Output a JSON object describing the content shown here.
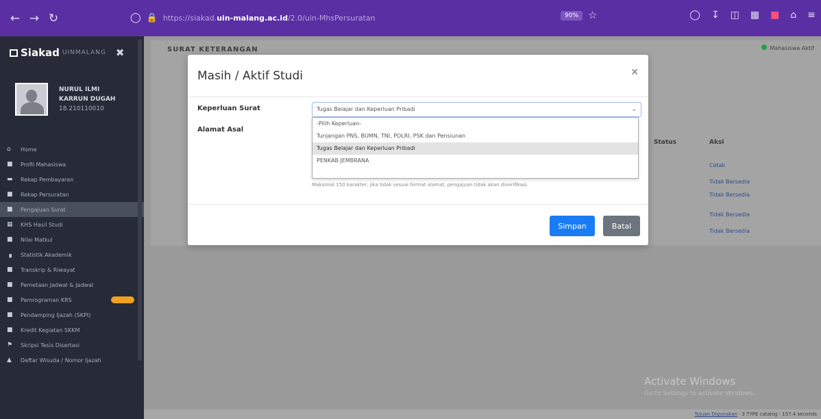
{
  "browser": {
    "url_prefix": "https://siakad.",
    "url_host": "uin-malang.ac.id",
    "url_path": "/2.0/uin-MhsPersuratan",
    "zoom": "90%"
  },
  "sidebar": {
    "brand": "Siakad",
    "brand_sub": "UINMALANG",
    "profile_name_1": "NURUL ILMI",
    "profile_name_2": "KARRUN DUGAH",
    "profile_nim": "18.210110010",
    "items": [
      {
        "label": "Home",
        "icon": "home-icon"
      },
      {
        "label": "Profil Mahasiswa",
        "icon": "user-icon"
      },
      {
        "label": "Rekap Pembayaran",
        "icon": "card-icon"
      },
      {
        "label": "Rekap Persuratan",
        "icon": "doc-icon"
      },
      {
        "label": "Pengajuan Surat",
        "icon": "doc-icon"
      },
      {
        "label": "KHS Hasil Studi",
        "icon": "grid-icon"
      },
      {
        "label": "Nilai Matkul",
        "icon": "doc-icon"
      },
      {
        "label": "Statistik Akademik",
        "icon": "chart-icon"
      },
      {
        "label": "Transkrip & Riwayat",
        "icon": "doc-icon"
      },
      {
        "label": "Pemetaan Jadwal & Jadwal",
        "icon": "doc-icon"
      },
      {
        "label": "Pemrograman KRS",
        "icon": "doc-icon"
      },
      {
        "label": "Pendamping Ijazah (SKPI)",
        "icon": "doc-icon"
      },
      {
        "label": "Kredit Kegiatan SKKM",
        "icon": "doc-icon"
      },
      {
        "label": "Skripsi Tesis Disertasi",
        "icon": "flag-icon"
      },
      {
        "label": "Daftar Wisuda / Nomor Ijazah",
        "icon": "grad-icon"
      }
    ]
  },
  "main": {
    "section_title": "SURAT KETERANGAN",
    "online_label": "Mahasiswa Aktif",
    "col_status": "Status",
    "col_aksi": "Aksi",
    "rows_aksi": [
      "Cetak",
      "Tidak Bersedia",
      "Tidak Bersedia",
      "Tidak Bersedia",
      "Tidak Bersedia"
    ],
    "activate_title": "Activate Windows",
    "activate_sub": "Go to Settings to activate Windows.",
    "footer_link": "Tujuan Digunakan",
    "footer_rest": "3 TYPE catalog · 157.4 seconds"
  },
  "modal": {
    "title": "Masih / Aktif Studi",
    "label_keperluan": "Keperluan Surat",
    "label_alamat": "Alamat Asal",
    "selected_value": "Tugas Belajar dan Keperluan Pribadi",
    "options": [
      "-Pilih Keperluan-",
      "Tunjangan PNS, BUMN, TNI, POLRI, PSK dan Pensiunan",
      "Tugas Belajar dan Keperluan Pribadi",
      "PENKAB JEMBRANA"
    ],
    "selected_index": 2,
    "hint": "Maksimal 150 karakter, jika tidak sesuai format alamat, pengajuan tidak akan diverifikasi.",
    "btn_simpan": "Simpan",
    "btn_batal": "Batal"
  }
}
